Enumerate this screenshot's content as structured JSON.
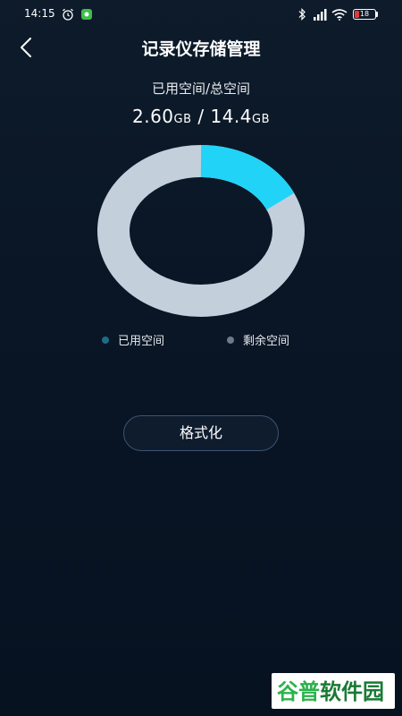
{
  "status_bar": {
    "time": "14:15",
    "battery_level": "18",
    "icons": [
      "alarm-icon",
      "notification-icon",
      "bluetooth-icon",
      "signal-icon",
      "wifi-icon",
      "battery-icon"
    ]
  },
  "header": {
    "title": "记录仪存储管理",
    "back_icon": "chevron-left-icon"
  },
  "storage": {
    "label": "已用空间/总空间",
    "used_value": "2.60",
    "used_unit": "GB",
    "separator": " / ",
    "total_value": "14.4",
    "total_unit": "GB"
  },
  "chart_data": {
    "type": "pie",
    "donut": true,
    "labels": [
      "已用空间",
      "剩余空间"
    ],
    "values": [
      2.6,
      11.8
    ],
    "total": 14.4,
    "colors": {
      "used": "#22d3f8",
      "remaining": "#c4cfdc",
      "legend_used_dot": "#1e6b85",
      "legend_remaining_dot": "#6f7a87"
    }
  },
  "legend": {
    "used_label": "已用空间",
    "remaining_label": "剩余空间"
  },
  "actions": {
    "format_label": "格式化"
  },
  "watermark": {
    "text": "谷普软件园",
    "colors": {
      "first": "#2bb24c",
      "second": "#2bb24c",
      "rest": "#1a7a35",
      "background": "#ffffff"
    }
  }
}
